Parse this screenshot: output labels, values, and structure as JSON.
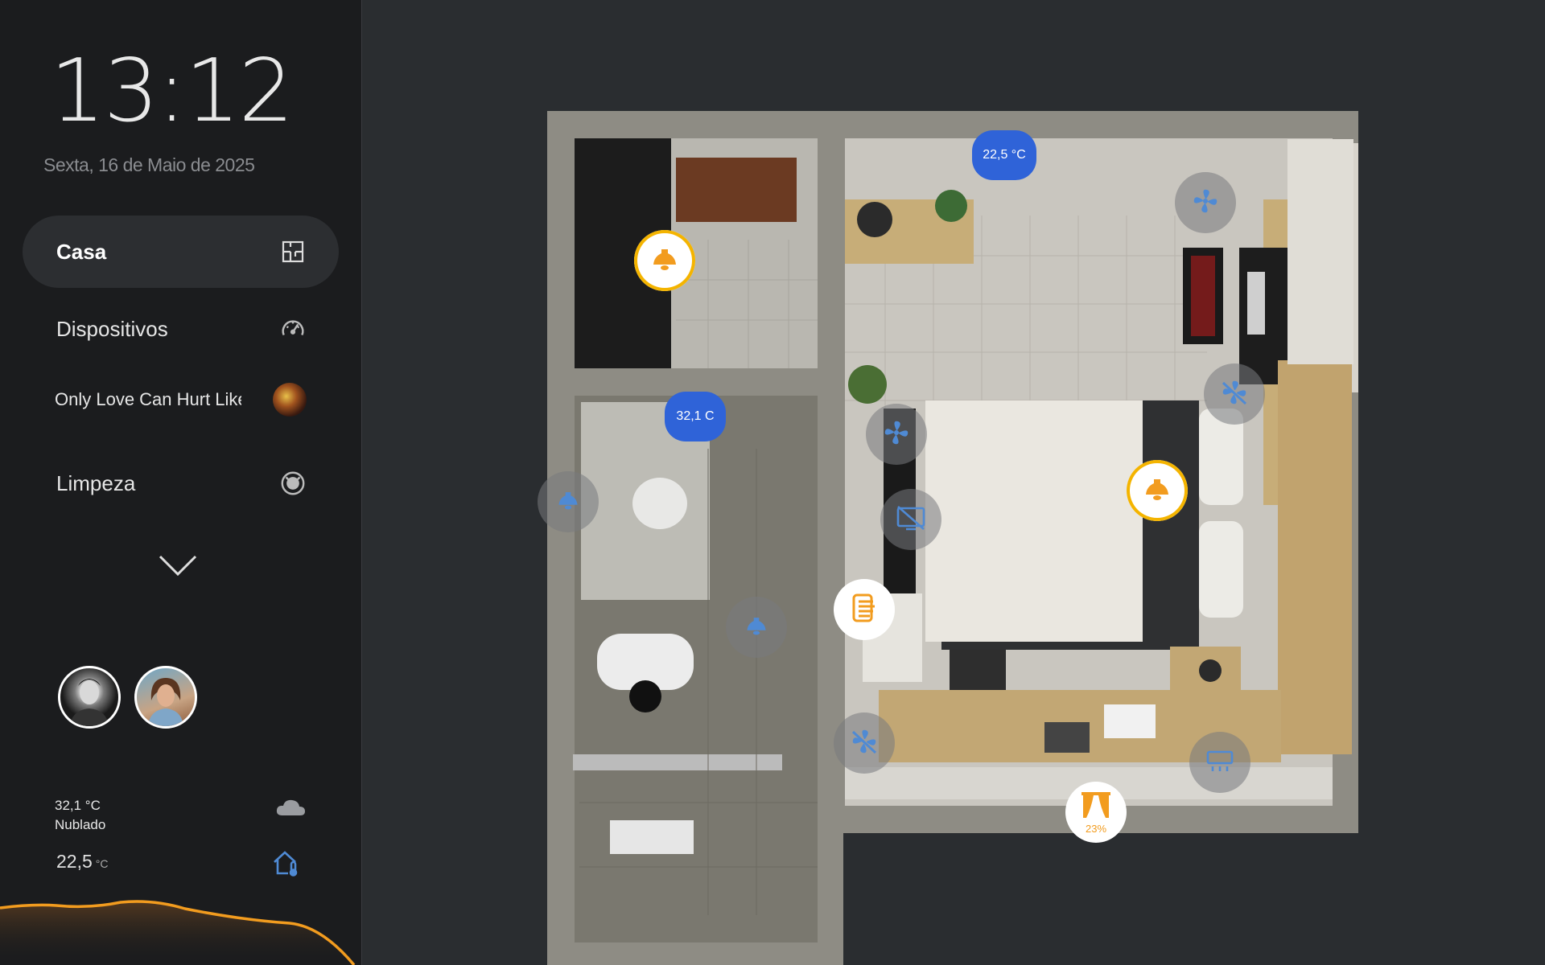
{
  "clock": {
    "time": "13:12",
    "date": "Sexta, 16 de Maio de 2025"
  },
  "nav": {
    "home": {
      "label": "Casa",
      "icon": "floorplan-icon"
    },
    "devices": {
      "label": "Dispositivos",
      "icon": "gauge-icon"
    },
    "media": {
      "label": "Only Love Can Hurt Like This",
      "icon": "album-art"
    },
    "cleaning": {
      "label": "Limpeza",
      "icon": "robot-vacuum-icon"
    },
    "more_icon": "chevron-down-icon"
  },
  "people": [
    {
      "name": "person-1",
      "icon": "avatar"
    },
    {
      "name": "person-2",
      "icon": "avatar"
    }
  ],
  "weather": {
    "outdoor_temp": "32,1 °C",
    "condition": "Nublado",
    "indoor_temp": "22,5",
    "indoor_unit": "°C"
  },
  "plan": {
    "bedroom_temp": "22,5 °C",
    "bathroom_temp": "32,1 C",
    "curtain_position": "23%"
  },
  "colors": {
    "accent_active": "#f4b400",
    "device_off": "#4f8ad4",
    "chip_blue": "#2f63d8",
    "wave": "#f29c1f"
  }
}
